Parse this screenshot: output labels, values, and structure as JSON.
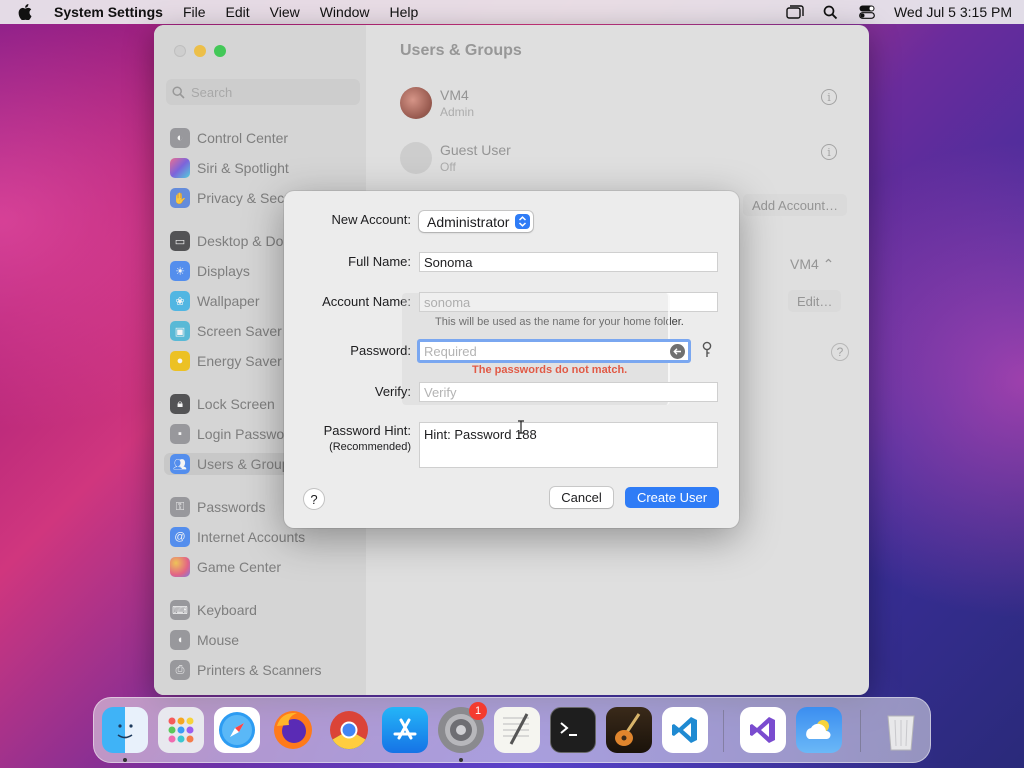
{
  "menubar": {
    "app_name": "System Settings",
    "menus": [
      "File",
      "Edit",
      "View",
      "Window",
      "Help"
    ],
    "clock": "Wed Jul 5  3:15 PM"
  },
  "window": {
    "title": "Users & Groups",
    "search_placeholder": "Search"
  },
  "sidebar": {
    "items": [
      {
        "label": "Control Center",
        "icon": "control-center-icon",
        "color": "#8e8e93"
      },
      {
        "label": "Siri & Spotlight",
        "icon": "siri-icon",
        "color": "#b65bd6"
      },
      {
        "label": "Privacy & Secu",
        "icon": "hand-icon",
        "color": "#4f7fe0"
      },
      {
        "label": "Desktop & Doc",
        "icon": "desktop-icon",
        "color": "#3a3a3c"
      },
      {
        "label": "Displays",
        "icon": "sun-icon",
        "color": "#3b82f6"
      },
      {
        "label": "Wallpaper",
        "icon": "wallpaper-icon",
        "color": "#37b2e8"
      },
      {
        "label": "Screen Saver",
        "icon": "screen-saver-icon",
        "color": "#41b6d9"
      },
      {
        "label": "Energy Saver",
        "icon": "bulb-icon",
        "color": "#f5c000"
      },
      {
        "label": "Lock Screen",
        "icon": "lock-icon",
        "color": "#3a3a3c"
      },
      {
        "label": "Login Passwor",
        "icon": "login-lock-icon",
        "color": "#8e8e93"
      },
      {
        "label": "Users & Group",
        "icon": "users-icon",
        "color": "#3b82f6"
      },
      {
        "label": "Passwords",
        "icon": "key-icon",
        "color": "#8e8e93"
      },
      {
        "label": "Internet Accounts",
        "icon": "at-icon",
        "color": "#3b82f6"
      },
      {
        "label": "Game Center",
        "icon": "game-center-icon",
        "color": "#e94e77"
      },
      {
        "label": "Keyboard",
        "icon": "keyboard-icon",
        "color": "#8e8e93"
      },
      {
        "label": "Mouse",
        "icon": "mouse-icon",
        "color": "#8e8e93"
      },
      {
        "label": "Printers & Scanners",
        "icon": "printer-icon",
        "color": "#8e8e93"
      }
    ]
  },
  "users": [
    {
      "name": "VM4",
      "role": "Admin"
    },
    {
      "name": "Guest User",
      "role": "Off"
    }
  ],
  "main_buttons": {
    "add_account": "Add Account…",
    "vm_select": "VM4",
    "edit": "Edit…",
    "help": "?"
  },
  "dialog": {
    "new_account_label": "New Account:",
    "account_type": "Administrator",
    "full_name_label": "Full Name:",
    "full_name_value": "Sonoma",
    "account_name_label": "Account Name:",
    "account_name_value": "sonoma",
    "account_name_note": "This will be used as the name for your home folder.",
    "password_label": "Password:",
    "password_placeholder": "Required",
    "password_error": "The passwords do not match.",
    "verify_label": "Verify:",
    "verify_placeholder": "Verify",
    "hint_label": "Password Hint:",
    "hint_sub": "(Recommended)",
    "hint_value": "Hint: Password 188",
    "help": "?",
    "cancel": "Cancel",
    "create": "Create User"
  },
  "dock": {
    "badge": "1",
    "apps": [
      "Finder",
      "Launchpad",
      "Safari",
      "Firefox",
      "Chrome",
      "App Store",
      "System Settings",
      "TextEdit",
      "Terminal",
      "GarageBand",
      "VS Code",
      "Visual Studio",
      "Weather",
      "Trash"
    ]
  },
  "colors": {
    "accent": "#2f7cf6",
    "error": "#e15a46"
  }
}
